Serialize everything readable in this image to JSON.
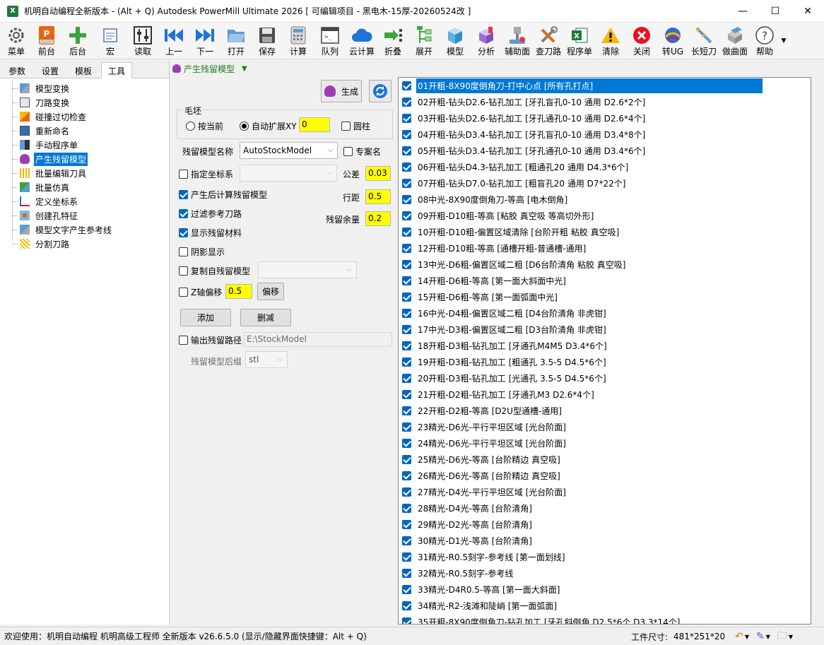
{
  "window": {
    "title": "机明自动编程全新版本 - (Alt + Q) Autodesk PowerMill Ultimate 2026    [ 可编辑项目 - 黑电木-15厚-20260524改 ]",
    "app_icon_text": "X",
    "minimize": "—",
    "maximize": "☐",
    "close": "✕"
  },
  "toolbar": {
    "items": [
      {
        "label": "菜单",
        "icon": "gear-icon"
      },
      {
        "label": "前台",
        "icon": "front-icon"
      },
      {
        "label": "后台",
        "icon": "plus-icon"
      },
      {
        "label": "宏",
        "icon": "macro-icon"
      },
      {
        "label": "读取",
        "icon": "sliders-icon"
      },
      {
        "label": "上一",
        "icon": "prev-icon"
      },
      {
        "label": "下一",
        "icon": "next-icon"
      },
      {
        "label": "打开",
        "icon": "folder-icon"
      },
      {
        "label": "保存",
        "icon": "save-icon"
      },
      {
        "label": "计算",
        "icon": "calculator-icon"
      },
      {
        "label": "队列",
        "icon": "queue-icon"
      },
      {
        "label": "云计算",
        "icon": "cloud-icon"
      },
      {
        "label": "折叠",
        "icon": "collapse-icon"
      },
      {
        "label": "展开",
        "icon": "expand-icon"
      },
      {
        "label": "模型",
        "icon": "cube-icon"
      },
      {
        "label": "分析",
        "icon": "analyze-icon"
      },
      {
        "label": "辅助面",
        "icon": "aux-surface-icon"
      },
      {
        "label": "查刀路",
        "icon": "tools-icon"
      },
      {
        "label": "程序单",
        "icon": "excel-icon"
      },
      {
        "label": "清除",
        "icon": "warning-icon"
      },
      {
        "label": "关闭",
        "icon": "close-circle-icon"
      },
      {
        "label": "转UG",
        "icon": "ug-icon"
      },
      {
        "label": "长短刀",
        "icon": "long-short-tool-icon"
      },
      {
        "label": "做曲面",
        "icon": "surface-icon"
      },
      {
        "label": "帮助",
        "icon": "help-icon"
      }
    ],
    "more": "▼"
  },
  "left": {
    "tabs": [
      "参数",
      "设置",
      "模板",
      "工具"
    ],
    "active_tab": 3,
    "tree": [
      "模型变换",
      "刀路变换",
      "碰撞过切检查",
      "重新命名",
      "手动程序单",
      "产生残留模型",
      "批量编辑刀具",
      "批量仿真",
      "定义坐标系",
      "创建孔特征",
      "模型文字产生参考线",
      "分割刀路"
    ],
    "selected_index": 5
  },
  "mid": {
    "header": "产生残留模型",
    "header_arrow": "▼",
    "generate_label": "生成",
    "blank_group_title": "毛坯",
    "radio_current": "按当前",
    "radio_auto": "自动扩展XY",
    "auto_expand_value": "0",
    "cylinder_label": "圆柱",
    "stock_name_label": "残留模型名称",
    "stock_name_value": "AutoStockModel",
    "dedicated_name_label": "专案名",
    "specify_cs_label": "指定坐标系",
    "tolerance_label": "公差",
    "tolerance_value": "0.03",
    "calc_after_label": "产生后计算残留模型",
    "stepover_label": "行距",
    "stepover_value": "0.5",
    "filter_ref_label": "过滤参考刀路",
    "allowance_label": "残留余量",
    "allowance_value": "0.2",
    "show_material_label": "显示残留材料",
    "shadow_label": "阴影显示",
    "copy_from_label": "复制自残留模型",
    "z_offset_label": "Z轴偏移",
    "z_offset_value": "0.5",
    "offset_button": "偏移",
    "add_button": "添加",
    "delete_button": "删减",
    "output_path_label": "输出残留路径",
    "output_path_value": "E:\\StockModel",
    "suffix_label": "残留模型后缀",
    "suffix_value": "stl",
    "combo_arrow": "⌵"
  },
  "operations": [
    "01开粗-8X90度倒角刀-打中心点 [所有孔打点]",
    "02开粗-钻头D2.6-钻孔加工 [牙孔盲孔0-10 通用 D2.6*2个]",
    "03开粗-钻头D2.6-钻孔加工 [牙孔通孔0-10 通用 D2.6*4个]",
    "04开粗-钻头D3.4-钻孔加工 [牙孔盲孔0-10 通用 D3.4*8个]",
    "05开粗-钻头D3.4-钻孔加工 [牙孔通孔0-10 通用 D3.4*6个]",
    "06开粗-钻头D4.3-钻孔加工 [粗通孔20 通用 D4.3*6个]",
    "07开粗-钻头D7.0-钻孔加工 [粗盲孔20 通用 D7*22个]",
    "08中光-8X90度倒角刀-等高 [电木倒角]",
    "09开粗-D10粗-等高 [粘胶 真空吸 等高切外形]",
    "10开粗-D10粗-偏置区域清除 [台阶开粗 粘胶 真空吸]",
    "12开粗-D10粗-等高 [通槽开粗-普通槽-通用]",
    "13中光-D6粗-偏置区域二粗 [D6台阶清角 粘胶 真空吸]",
    "14开粗-D6粗-等高 [第一面大斜面中光]",
    "15开粗-D6粗-等高 [第一面弧面中光]",
    "16中光-D4粗-偏置区域二粗 [D4台阶清角 非虎钳]",
    "17中光-D3粗-偏置区域二粗 [D3台阶清角 非虎钳]",
    "18开粗-D3粗-钻孔加工 [牙通孔M4M5 D3.4*6个]",
    "19开粗-D3粗-钻孔加工 [粗通孔 3.5-5 D4.5*6个]",
    "20开粗-D3粗-钻孔加工 [光通孔 3.5-5 D4.5*6个]",
    "21开粗-D2粗-钻孔加工 [牙通孔M3 D2.6*4个]",
    "22开粗-D2粗-等高 [D2U型通槽-通用]",
    "23精光-D6光-平行平坦区域 [光台阶面]",
    "24精光-D6光-平行平坦区域 [光台阶面]",
    "25精光-D6光-等高 [台阶精边 真空吸]",
    "26精光-D6光-等高 [台阶精边 真空吸]",
    "27精光-D4光-平行平坦区域 [光台阶面]",
    "28精光-D4光-等高 [台阶清角]",
    "29精光-D2光-等高 [台阶清角]",
    "30精光-D1光-等高 [台阶清角]",
    "31精光-R0.5刻字-参考线 [第一面划线]",
    "32精光-R0.5刻字-参考线",
    "33精光-D4R0.5-等高 [第一面大斜面]",
    "34精光-R2-浅滩和陡峭 [第一面弧面]",
    "35开粗-8X90度倒角刀-钻孔加工 [牙孔斜倒角 D2.5*6个 D3.3*14个]"
  ],
  "selected_operation": 0,
  "status": {
    "welcome": "欢迎使用：机明自动编程 机明高级工程师 全新版本 v26.6.5.0   (显示/隐藏界面快捷键：Alt + Q)",
    "size_label": "工件尺寸:",
    "size_value": "481*251*20"
  },
  "colors": {
    "selection": "#0078d7",
    "highlight_field": "#ffff00",
    "checkbox": "#0067c0",
    "header_green": "#1a7f1a"
  }
}
